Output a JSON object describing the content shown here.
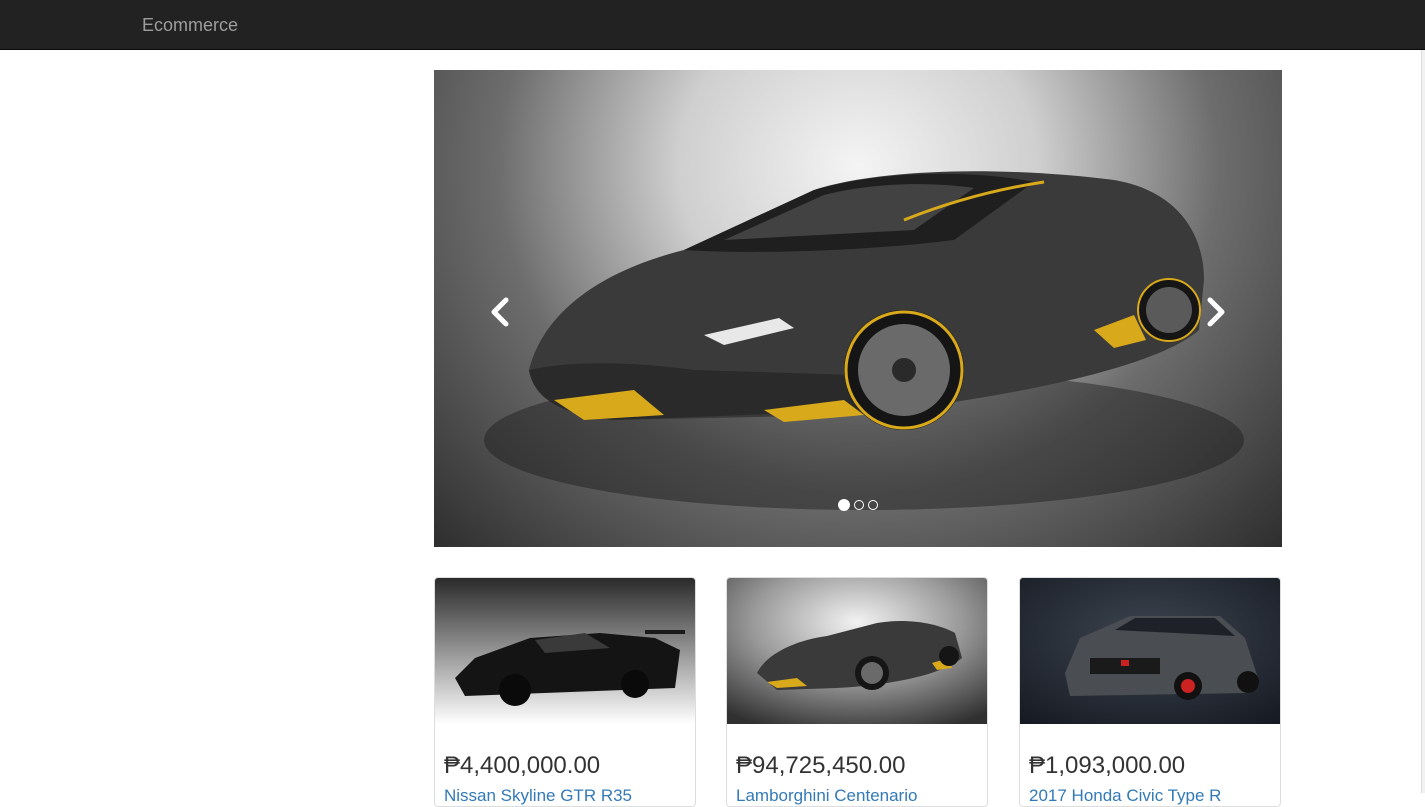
{
  "navbar": {
    "brand": "Ecommerce"
  },
  "carousel": {
    "image": "black carbon fiber supercar with yellow accents",
    "prev_icon": "chevron-left-icon",
    "next_icon": "chevron-right-icon",
    "slides": 3,
    "active_slide": 1
  },
  "products": [
    {
      "image": "black race car",
      "price": "₱4,400,000.00",
      "title": "Nissan Skyline GTR R35"
    },
    {
      "image": "black carbon fiber supercar",
      "price": "₱94,725,450.00",
      "title": "Lamborghini Centenario"
    },
    {
      "image": "dark grey hatchback",
      "price": "₱1,093,000.00",
      "title": "2017 Honda Civic Type R"
    }
  ],
  "colors": {
    "navbar": "#222222",
    "link": "#337ab7",
    "accent_yellow": "#d8a91b"
  }
}
